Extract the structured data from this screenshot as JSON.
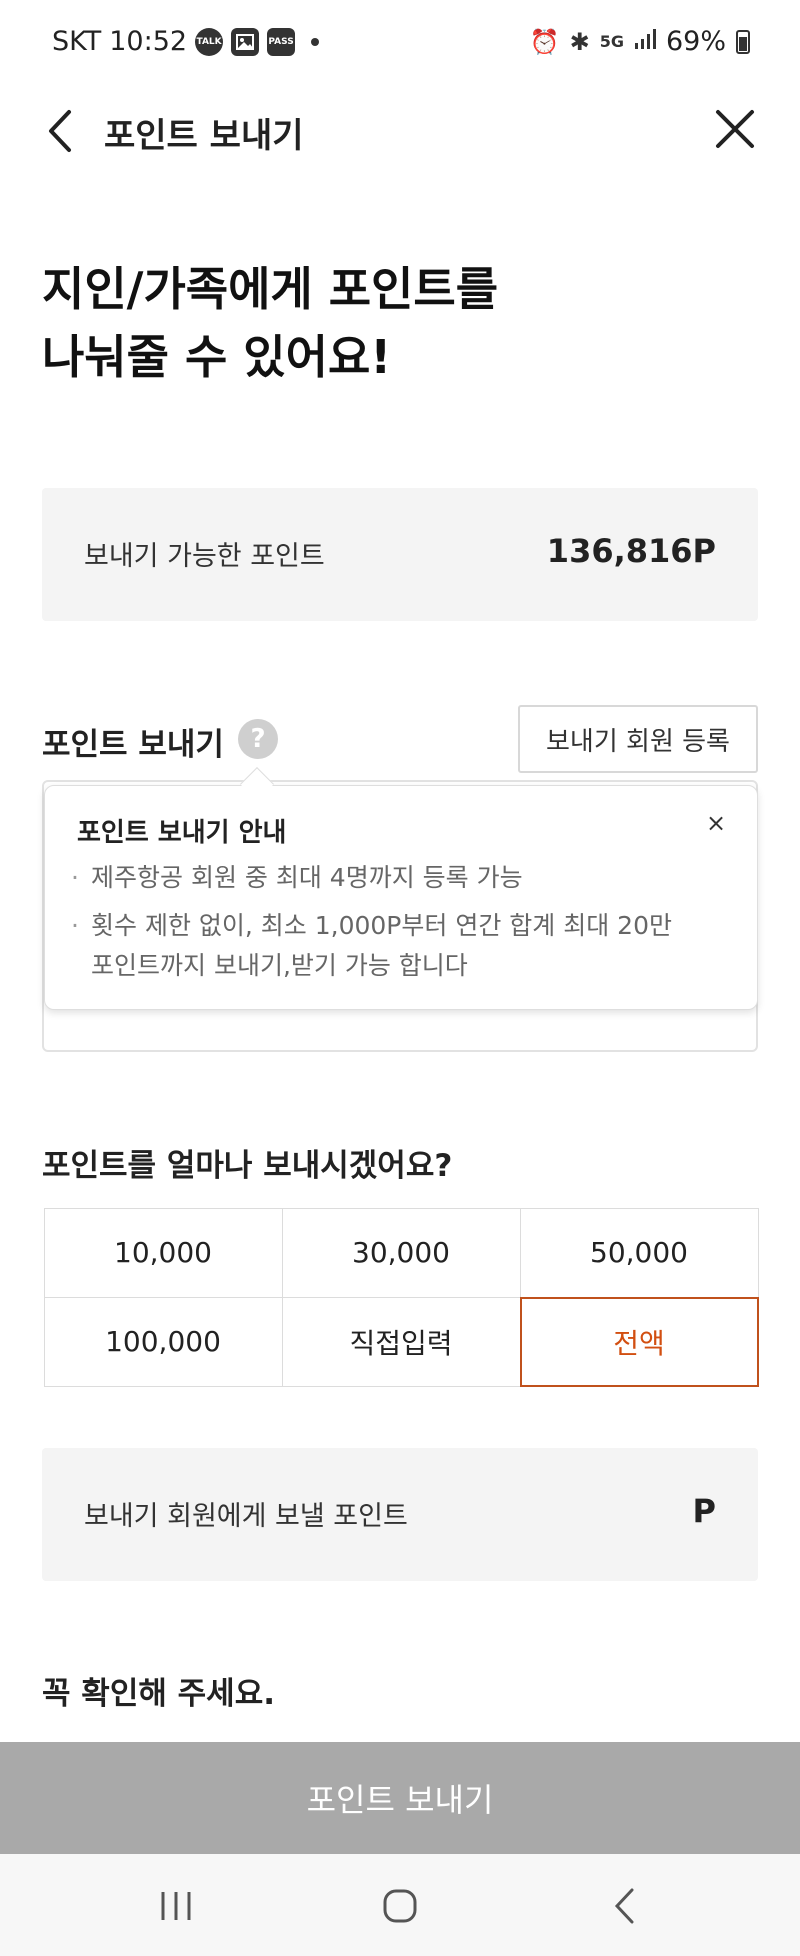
{
  "status_bar": {
    "carrier": "SKT",
    "time": "10:52",
    "app_icons": [
      "talk-icon",
      "gallery-icon",
      "pass-icon"
    ],
    "talk_label": "TALK",
    "pass_label": "PASS",
    "network": "5G",
    "battery": "69%"
  },
  "header": {
    "title": "포인트 보내기"
  },
  "headline": {
    "line1": "지인/가족에게 포인트를",
    "line2": "나눠줄 수 있어요!"
  },
  "available": {
    "label": "보내기 가능한 포인트",
    "value": "136,816P"
  },
  "send_section": {
    "title": "포인트 보내기",
    "help": "?",
    "register_label": "보내기 회원 등록"
  },
  "tooltip": {
    "title": "포인트 보내기 안내",
    "close": "×",
    "items": [
      "제주항공 회원 중 최대 4명까지 등록 가능",
      "횟수 제한 없이, 최소 1,000P부터 연간 합계 최대 20만 포인트까지 보내기,받기 가능 합니다"
    ]
  },
  "amount": {
    "title": "포인트를 얼마나 보내시겠어요?",
    "options": [
      "10,000",
      "30,000",
      "50,000",
      "100,000",
      "직접입력",
      "전액"
    ],
    "selected": "전액"
  },
  "send_to": {
    "label": "보내기 회원에게 보낼 포인트",
    "unit": "P"
  },
  "notice_title": "꼭 확인해 주세요.",
  "submit_label": "포인트 보내기",
  "colors": {
    "accent": "#d24f11",
    "disabled_button": "#a9a9a9",
    "panel_bg": "#f4f4f4"
  }
}
